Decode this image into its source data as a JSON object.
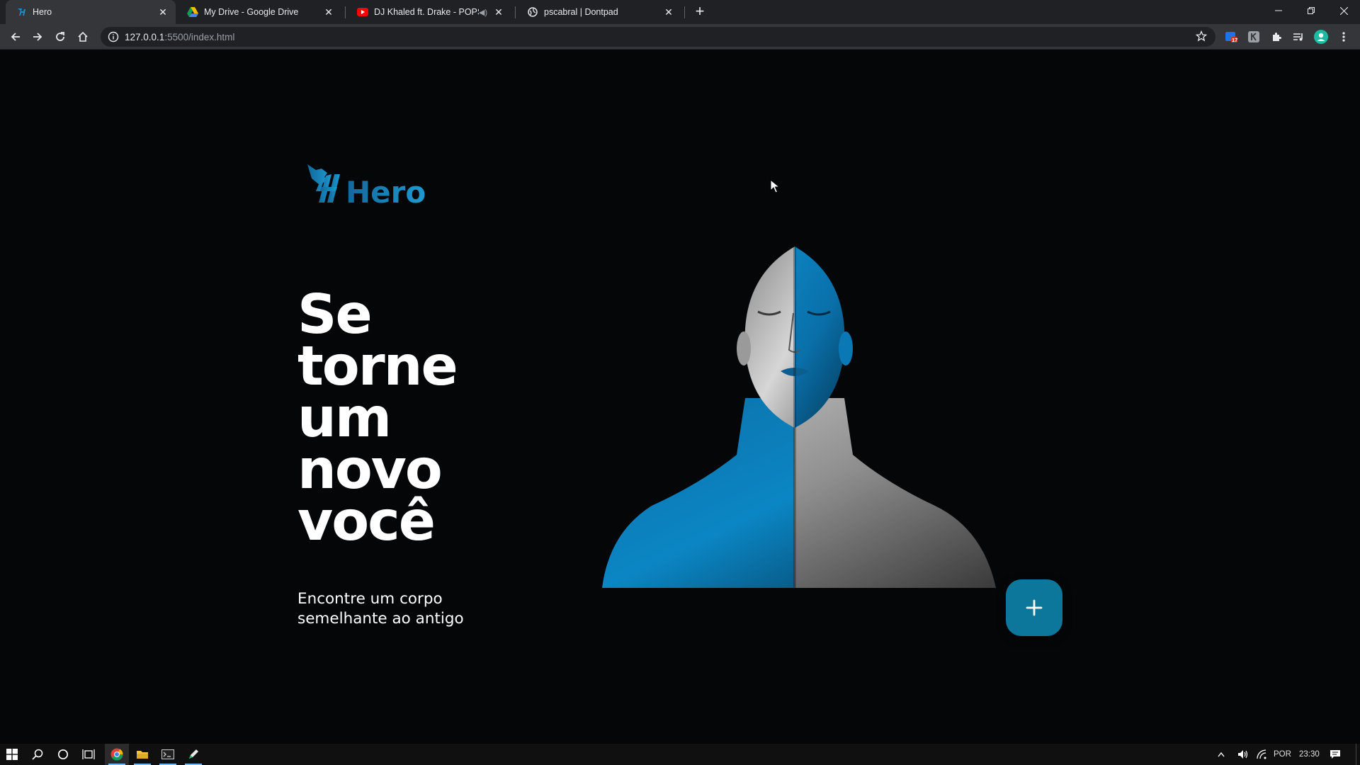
{
  "browser": {
    "tabs": [
      {
        "title": "Hero",
        "icon": "hero-favicon",
        "active": true
      },
      {
        "title": "My Drive - Google Drive",
        "icon": "google-drive-favicon"
      },
      {
        "title": "DJ Khaled ft. Drake - POPSTA",
        "icon": "youtube-favicon",
        "muted": true
      },
      {
        "title": "pscabral | Dontpad",
        "icon": "globe-favicon"
      }
    ],
    "new_tab_label": "+",
    "url_host": "127.0.0.1",
    "url_path": ":5500/index.html",
    "extension_badge": "17"
  },
  "page": {
    "logo_text": "Hero",
    "headline": [
      "Se",
      "torne",
      "um",
      "novo",
      "você"
    ],
    "subline": [
      "Encontre um corpo",
      "semelhante ao antigo"
    ],
    "fab_icon": "plus-icon",
    "accent_color": "#0c779b"
  },
  "taskbar": {
    "language": "POR",
    "time": "23:30"
  }
}
